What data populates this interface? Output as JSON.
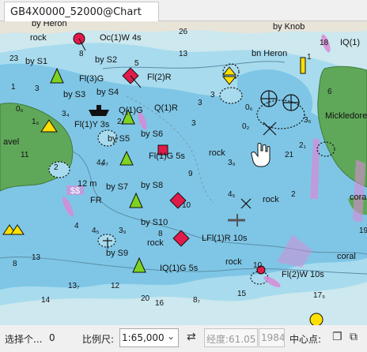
{
  "tab": {
    "title": "GB4X0000_52000@Chart"
  },
  "chart_labels": {
    "heron_top": "by Heron",
    "rock_tl": "rock",
    "oc_light": "Oc(1)W 4s",
    "knob": "by Knob",
    "iq1": "IQ(1)",
    "by_s1": "by S1",
    "by_s2": "by S2",
    "bn_heron": "bn Heron",
    "fl3g": "Fl(3)G",
    "fl2r_top": "Fl(2)R",
    "by_s3": "by S3",
    "by_s4": "by S4",
    "q1g": "Q(1)G",
    "q1r": "Q(1)R",
    "mickledore": "Mickledore",
    "fl1y": "Fl(1)Y 3s",
    "by_s5": "by S5",
    "by_s6": "by S6",
    "avel": "avel",
    "rock_mid": "rock",
    "fl1g": "Fl(1)G 5s",
    "twelve_m": "12 m",
    "by_s7": "by S7",
    "by_s8": "by S8",
    "fr": "FR",
    "rock_right": "rock",
    "cora": "cora",
    "by_s10": "by S10",
    "lfl": "LFl(1)R 10s",
    "by_s9": "by S9",
    "rock_low": "rock",
    "coral": "coral",
    "rock_low2": "rock",
    "iq1g": "IQ(1)G 5s",
    "fl2w": "Fl(2)W 10s"
  },
  "depths": {
    "d1": "26",
    "d2": "23",
    "d3": "8",
    "d4": "13",
    "d5": "5",
    "d6": "1",
    "d7": "3",
    "d8": "0₆",
    "d9": "3₄",
    "d10": "3",
    "d11": "0₆",
    "d12": "2",
    "d13": "3",
    "d14": "4₇",
    "d15": "2₇",
    "d16": "1₆",
    "d17": "11",
    "d18": "3₉",
    "d19": "4₅",
    "d20": "10",
    "d21": "4₅",
    "d22": "8",
    "d23": "4",
    "d24": "3₉",
    "d25": "15",
    "d26": "13₇",
    "d27": "12",
    "d28": "20",
    "d29": "8₇",
    "d30": "16",
    "d31": "17₅",
    "d32": "13",
    "d33": "14",
    "d34": "10",
    "d35": "18",
    "d36": "6",
    "d37": "1",
    "d38": "21",
    "d39": "3₆",
    "d40": "2₁",
    "d41": "0₂",
    "d42": "3",
    "d43": "4₉",
    "d44": "2",
    "d45": "8",
    "d46": "9",
    "d47": "19"
  },
  "status": {
    "selected_label": "选择个...",
    "selected_count": "0",
    "scale_label": "比例尺:",
    "scale_value": "1:65,000",
    "lon_value": "经度:61.05",
    "lat_value": "1984",
    "center_label": "中心点:"
  },
  "colors": {
    "shallow": "#7fc6e6",
    "mid": "#a8dbee",
    "deep": "#cde8ee",
    "land": "#5fa85a",
    "buoy_red": "#e01b4a",
    "buoy_green": "#7ed321",
    "buoy_yellow": "#ffe000",
    "light_flare": "#d98ad6"
  },
  "icons": {
    "cursor": "hand-pointer-icon",
    "swap": "swap-arrows-icon",
    "copy1": "copy-icon",
    "copy2": "duplicate-icon"
  }
}
